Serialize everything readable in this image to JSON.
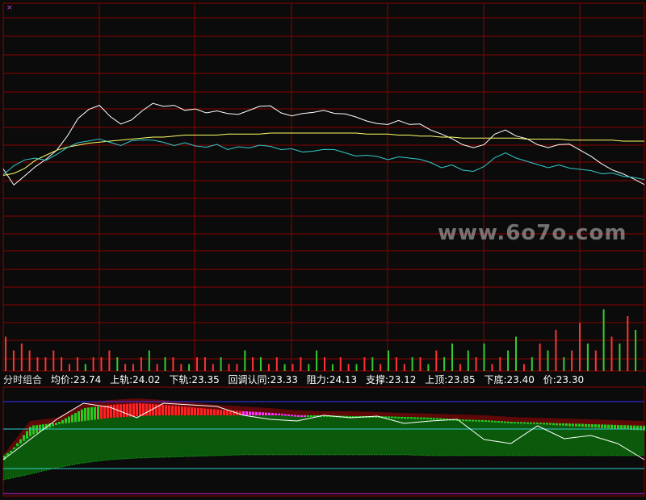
{
  "corner_marker": "×",
  "watermark": "www.6o7o.com",
  "legend": {
    "title": "分时组合",
    "items": [
      {
        "text": "均价:23.74"
      },
      {
        "text": "上轨:24.02"
      },
      {
        "text": "下轨:23.35"
      },
      {
        "text": "回调认同:23.33"
      },
      {
        "text": "阻力:24.13"
      },
      {
        "text": "支撑:23.12"
      },
      {
        "text": "上顶:23.85"
      },
      {
        "text": "下底:23.40"
      },
      {
        "text": "价:23.30"
      }
    ]
  },
  "colors": {
    "background": "#0b0b0b",
    "grid": "#8b0000",
    "price_line": "#ffffff",
    "avg_line": "#ffff66",
    "cyan_line": "#33cccc",
    "volume_up": "#ff3333",
    "volume_down": "#33cc33",
    "band_dark_green": "#0b5a0b",
    "band_green": "#22cc22",
    "band_red": "#ff2222",
    "band_magenta": "#ff33ff",
    "band_dark_red": "#600808",
    "resistance_line": "#3333ff",
    "support_line": "#cc22cc",
    "mid_line": "#33cccc"
  },
  "chart_data": [
    {
      "type": "line",
      "panel": "intraday price",
      "x": [
        0,
        4,
        8,
        12,
        16,
        20,
        24,
        28,
        32,
        36,
        40,
        44,
        48,
        52,
        56,
        60,
        64,
        68,
        72,
        76,
        80,
        84,
        88,
        92,
        96,
        100,
        104,
        108,
        112,
        116,
        120,
        124,
        128,
        132,
        136,
        140,
        144,
        148,
        152,
        156,
        160,
        164,
        168,
        172,
        176,
        180,
        184,
        188,
        192,
        196,
        200,
        204,
        208,
        212,
        216,
        220,
        224,
        228,
        232,
        236,
        240
      ],
      "series": [
        {
          "values": [
            23.45,
            23.3,
            23.4,
            23.5,
            23.55,
            23.65,
            23.8,
            23.95,
            24.05,
            24.1,
            24.0,
            23.9,
            23.95,
            24.05,
            24.1,
            24.08,
            24.1,
            24.06,
            24.05,
            24.02,
            24.05,
            24.0,
            24.0,
            24.05,
            24.1,
            24.08,
            24.02,
            24.0,
            24.0,
            24.02,
            24.05,
            24.03,
            24.0,
            23.98,
            23.95,
            23.9,
            23.9,
            23.95,
            23.92,
            23.9,
            23.85,
            23.82,
            23.75,
            23.7,
            23.68,
            23.72,
            23.8,
            23.85,
            23.8,
            23.75,
            23.7,
            23.68,
            23.72,
            23.7,
            23.65,
            23.6,
            23.5,
            23.45,
            23.42,
            23.38,
            23.3
          ]
        },
        {
          "values": [
            23.4,
            23.42,
            23.47,
            23.55,
            23.6,
            23.65,
            23.68,
            23.7,
            23.72,
            23.73,
            23.74,
            23.75,
            23.76,
            23.77,
            23.78,
            23.78,
            23.79,
            23.8,
            23.8,
            23.8,
            23.8,
            23.81,
            23.81,
            23.81,
            23.81,
            23.82,
            23.82,
            23.82,
            23.82,
            23.82,
            23.82,
            23.82,
            23.82,
            23.82,
            23.81,
            23.81,
            23.81,
            23.8,
            23.8,
            23.79,
            23.79,
            23.78,
            23.78,
            23.77,
            23.77,
            23.77,
            23.77,
            23.77,
            23.77,
            23.76,
            23.76,
            23.76,
            23.76,
            23.75,
            23.75,
            23.75,
            23.75,
            23.75,
            23.74,
            23.74,
            23.74
          ]
        },
        {
          "values": [
            23.4,
            23.5,
            23.55,
            23.58,
            23.55,
            23.6,
            23.68,
            23.72,
            23.75,
            23.76,
            23.72,
            23.7,
            23.74,
            23.76,
            23.75,
            23.72,
            23.7,
            23.72,
            23.7,
            23.68,
            23.7,
            23.66,
            23.68,
            23.68,
            23.7,
            23.68,
            23.66,
            23.66,
            23.64,
            23.64,
            23.65,
            23.66,
            23.62,
            23.6,
            23.6,
            23.58,
            23.56,
            23.58,
            23.58,
            23.56,
            23.52,
            23.48,
            23.5,
            23.46,
            23.44,
            23.48,
            23.58,
            23.62,
            23.58,
            23.54,
            23.5,
            23.48,
            23.5,
            23.48,
            23.46,
            23.44,
            23.42,
            23.42,
            23.4,
            23.38,
            23.35
          ]
        }
      ]
    },
    {
      "type": "bar",
      "panel": "volume",
      "values": [
        5,
        3,
        4,
        3,
        2,
        2,
        3,
        2,
        1,
        2,
        1,
        2,
        2,
        3,
        2,
        1,
        1,
        2,
        3,
        1,
        2,
        2,
        1,
        1,
        2,
        2,
        1,
        2,
        1,
        1,
        3,
        2,
        2,
        1,
        2,
        1,
        1,
        2,
        1,
        3,
        2,
        1,
        2,
        1,
        1,
        2,
        2,
        1,
        3,
        2,
        1,
        2,
        2,
        1,
        3,
        2,
        4,
        1,
        3,
        2,
        4,
        1,
        2,
        3,
        5,
        1,
        2,
        4,
        3,
        6,
        2,
        3,
        7,
        4,
        3,
        9,
        5,
        4,
        8,
        6
      ],
      "up": [
        1,
        1,
        1,
        1,
        1,
        1,
        1,
        1,
        1,
        1,
        0,
        1,
        1,
        1,
        0,
        1,
        1,
        1,
        0,
        1,
        0,
        1,
        1,
        0,
        1,
        1,
        1,
        0,
        1,
        1,
        0,
        1,
        0,
        1,
        1,
        0,
        1,
        1,
        0,
        0,
        1,
        0,
        1,
        1,
        0,
        1,
        0,
        1,
        0,
        1,
        1,
        0,
        1,
        0,
        1,
        0,
        0,
        1,
        0,
        1,
        0,
        1,
        1,
        0,
        0,
        1,
        0,
        1,
        0,
        1,
        0,
        1,
        1,
        0,
        1,
        0,
        1,
        0,
        1,
        0
      ]
    },
    {
      "type": "area",
      "panel": "分时组合",
      "x": [
        0,
        10,
        20,
        30,
        40,
        50,
        60,
        70,
        80,
        90,
        100,
        110,
        120,
        130,
        140,
        150,
        160,
        170,
        180,
        190,
        200,
        210,
        220,
        230,
        240
      ],
      "series": [
        {
          "values": [
            23.35,
            23.6,
            23.74,
            23.78,
            23.82,
            23.84,
            23.85,
            23.85,
            23.85,
            23.85,
            23.85,
            23.85,
            23.85,
            23.84,
            23.84,
            23.83,
            23.82,
            23.8,
            23.78,
            23.76,
            23.74,
            23.72,
            23.7,
            23.68,
            23.66
          ]
        },
        {
          "values": [
            23.05,
            23.12,
            23.2,
            23.26,
            23.3,
            23.32,
            23.33,
            23.34,
            23.35,
            23.36,
            23.36,
            23.36,
            23.36,
            23.36,
            23.36,
            23.36,
            23.35,
            23.35,
            23.35,
            23.35,
            23.35,
            23.35,
            23.35,
            23.35,
            23.35
          ]
        },
        {
          "values": [
            23.3,
            23.72,
            23.76,
            23.94,
            23.98,
            24.0,
            23.98,
            23.95,
            23.92,
            23.9,
            23.88,
            23.85,
            23.84,
            23.84,
            23.83,
            23.82,
            23.81,
            23.8,
            23.79,
            23.77,
            23.76,
            23.75,
            23.74,
            23.73,
            23.72
          ]
        },
        {
          "values": [
            23.3,
            23.55,
            23.8,
            24.0,
            23.95,
            23.82,
            24.0,
            23.98,
            23.96,
            23.85,
            23.8,
            23.78,
            23.85,
            23.82,
            23.84,
            23.75,
            23.78,
            23.8,
            23.55,
            23.5,
            23.72,
            23.56,
            23.6,
            23.5,
            23.3
          ]
        }
      ]
    }
  ]
}
